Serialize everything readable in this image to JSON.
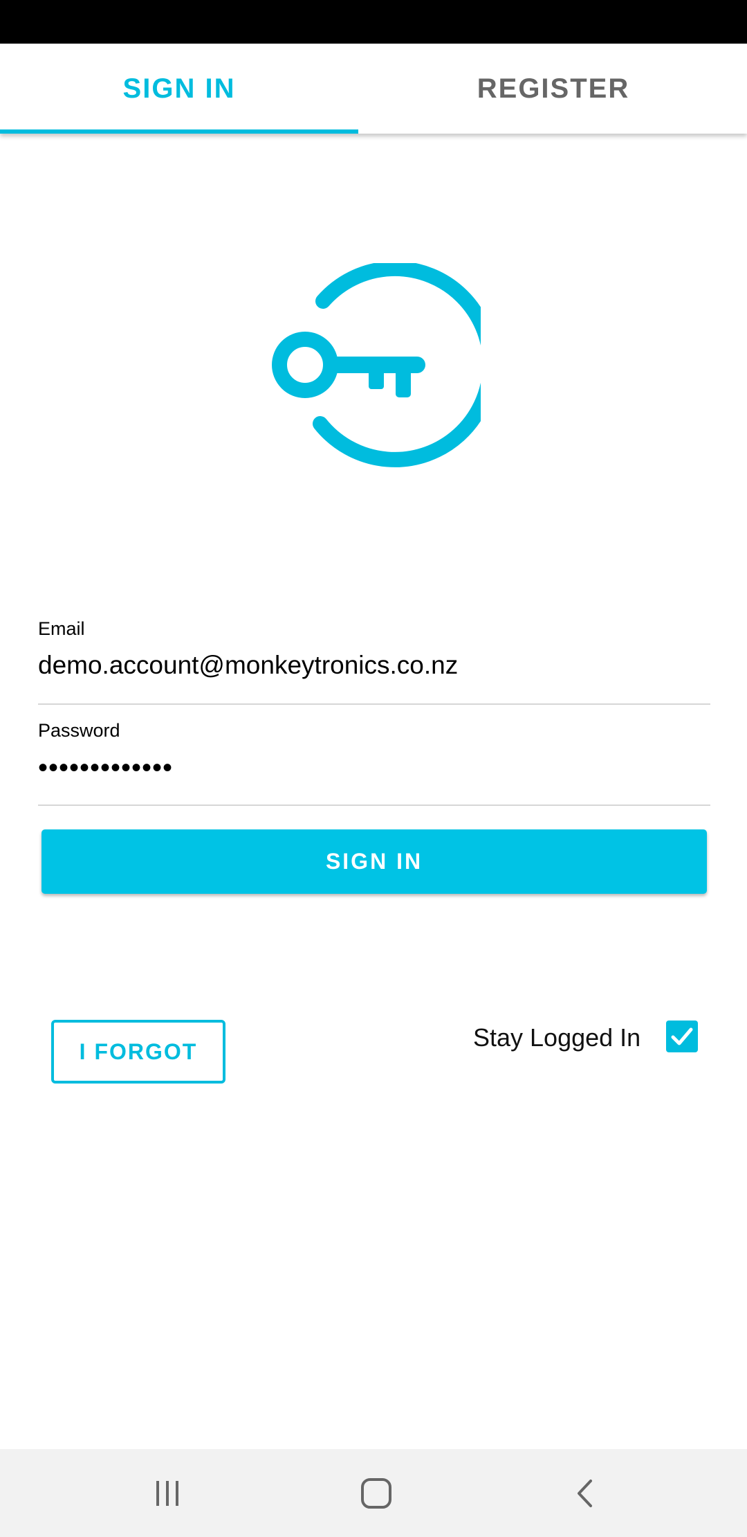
{
  "tabs": [
    {
      "label": "SIGN IN",
      "selected": true
    },
    {
      "label": "REGISTER",
      "selected": false
    }
  ],
  "logo": {
    "icon": "key-circle-icon",
    "color": "#00bcde"
  },
  "form": {
    "email": {
      "label": "Email",
      "value": "demo.account@monkeytronics.co.nz"
    },
    "password": {
      "label": "Password",
      "value": "•••••••••••••"
    },
    "signin_label": "SIGN IN",
    "forgot_label": "I FORGOT",
    "stay_logged_in": {
      "label": "Stay Logged In",
      "checked": true
    }
  },
  "nav": {
    "items": [
      "recent-apps-icon",
      "home-icon",
      "back-icon"
    ]
  },
  "colors": {
    "accent": "#00bcde",
    "button": "#00c3e5",
    "tab_inactive": "#666666"
  }
}
